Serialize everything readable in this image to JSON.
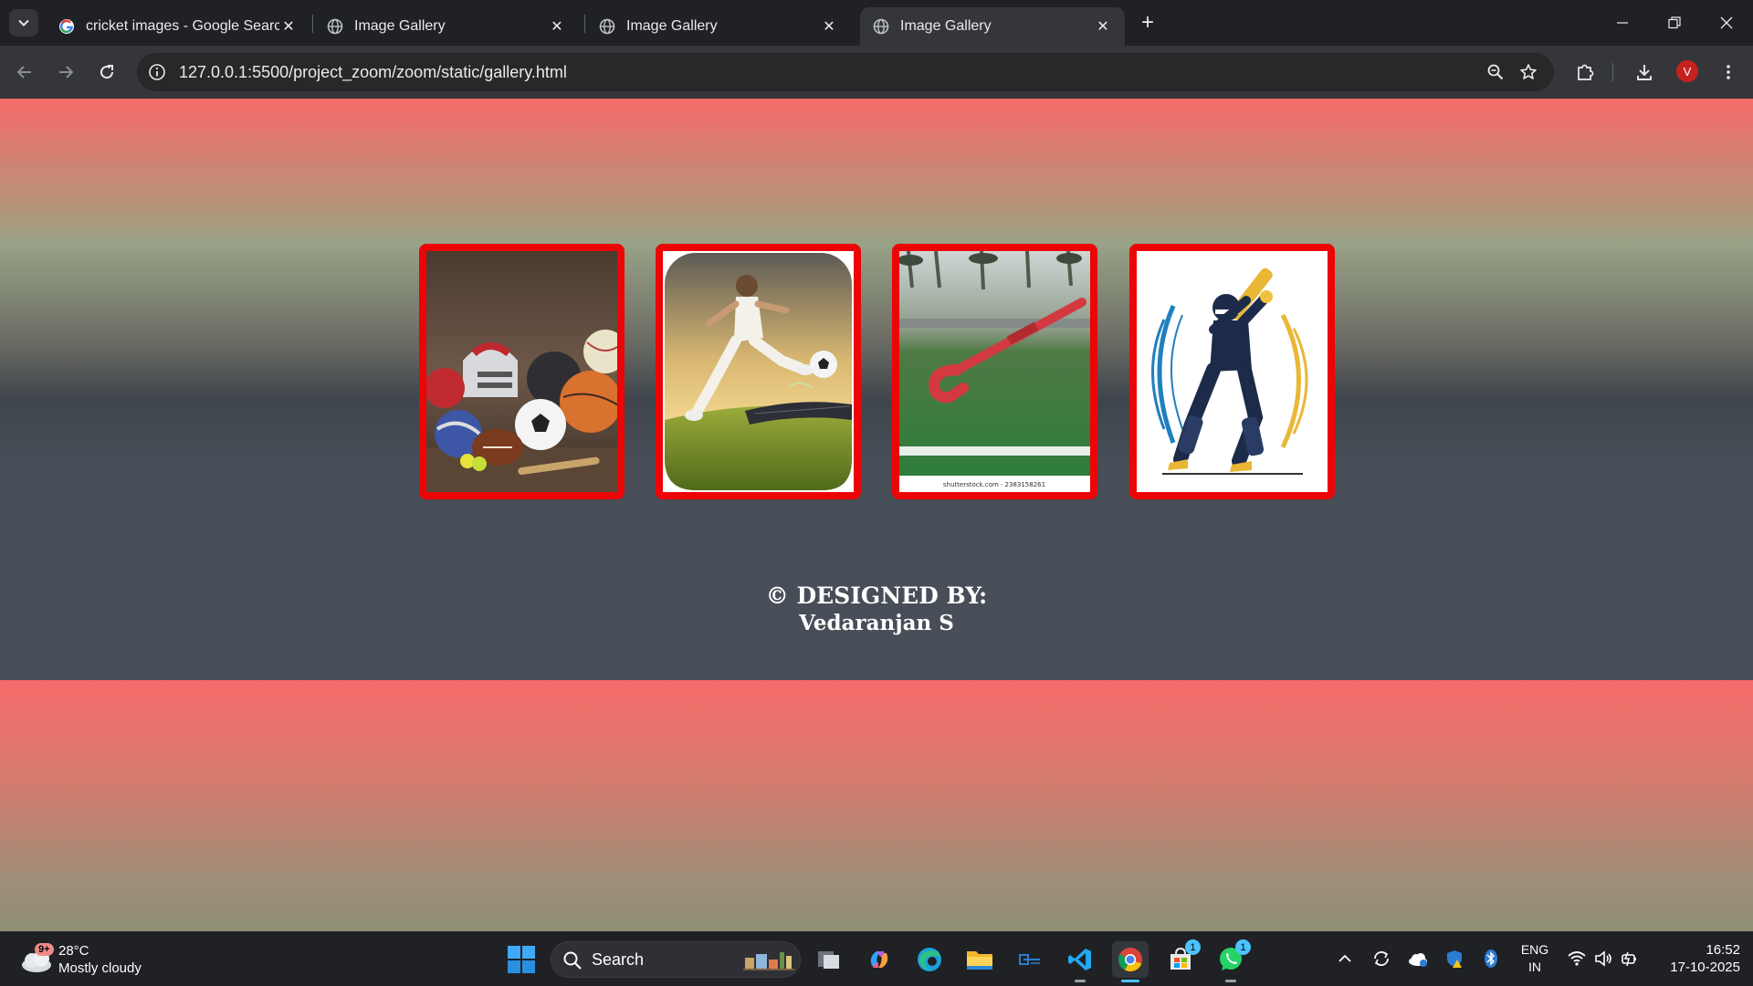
{
  "browser": {
    "tabs": [
      {
        "title": "cricket images - Google Search",
        "favicon": "google-g-icon",
        "active": false
      },
      {
        "title": "Image Gallery",
        "favicon": "globe-icon",
        "active": false
      },
      {
        "title": "Image Gallery",
        "favicon": "globe-icon",
        "active": false
      },
      {
        "title": "Image Gallery",
        "favicon": "globe-icon",
        "active": true
      }
    ],
    "address": "127.0.0.1:5500/project_zoom/zoom/static/gallery.html",
    "profile_initial": "V",
    "accent_color": "#c5221f"
  },
  "page": {
    "gallery": [
      {
        "subject": "assorted sports balls and helmet",
        "icon": "photo-sports-equipment"
      },
      {
        "subject": "footballer kicking ball",
        "icon": "photo-football-kick"
      },
      {
        "subject": "hockey stick on turf",
        "icon": "photo-hockey-stick",
        "watermark": "shutterstock.com · 2383158261"
      },
      {
        "subject": "cricket batsman illustration",
        "icon": "illustration-cricket-batsman"
      }
    ],
    "footer": {
      "line1": "© DESIGNED BY:",
      "line2": "Vedaranjan S"
    },
    "colors": {
      "card_border": "#ec0406",
      "gradient_top": "#f76b6a",
      "gradient_bottom": "#484e57"
    }
  },
  "taskbar": {
    "weather": {
      "temp": "28°C",
      "condition": "Mostly cloudy",
      "badge": "9+"
    },
    "search_label": "Search",
    "apps": [
      {
        "name": "task-view",
        "badge": ""
      },
      {
        "name": "copilot",
        "badge": ""
      },
      {
        "name": "edge",
        "badge": ""
      },
      {
        "name": "file-explorer",
        "badge": ""
      },
      {
        "name": "app-blue",
        "badge": ""
      },
      {
        "name": "vscode",
        "badge": ""
      },
      {
        "name": "chrome",
        "badge": ""
      },
      {
        "name": "microsoft-store",
        "badge": "1"
      },
      {
        "name": "whatsapp",
        "badge": "1"
      }
    ],
    "language": {
      "line1": "ENG",
      "line2": "IN"
    },
    "time": "16:52",
    "date": "17-10-2025"
  }
}
